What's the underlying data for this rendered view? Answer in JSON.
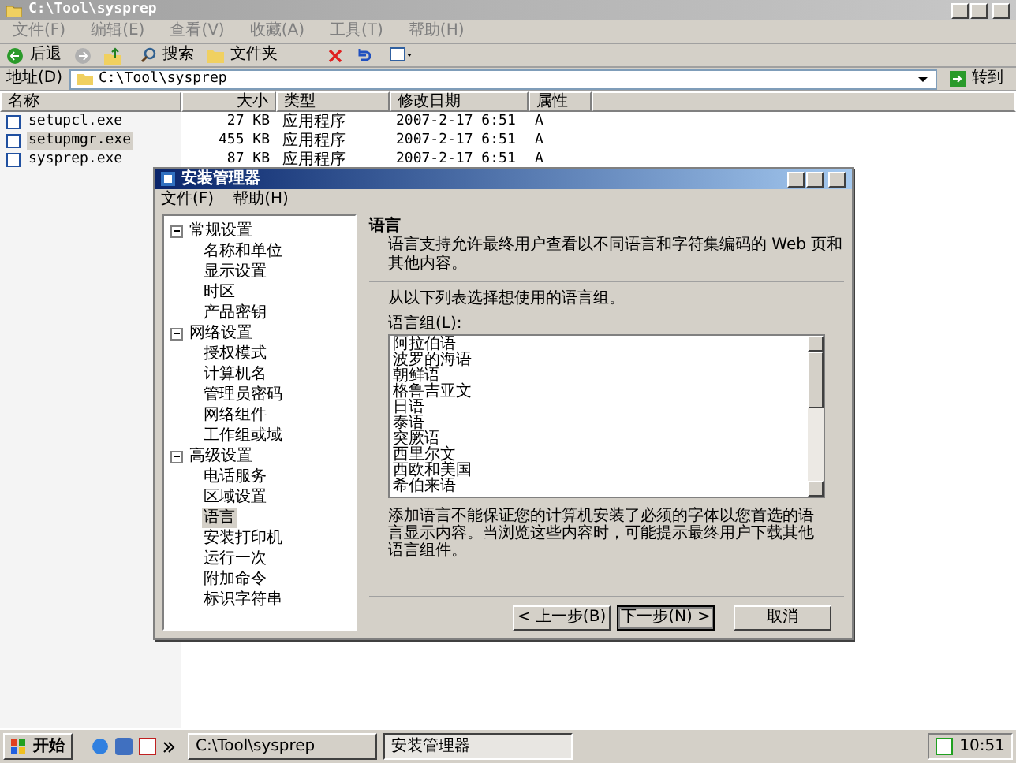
{
  "explorer": {
    "title": "C:\\Tool\\sysprep",
    "menu": [
      "文件(F)",
      "编辑(E)",
      "查看(V)",
      "收藏(A)",
      "工具(T)",
      "帮助(H)"
    ],
    "toolbar": {
      "back": "后退",
      "search": "搜索",
      "folders": "文件夹"
    },
    "address": {
      "label": "地址(D)",
      "value": "C:\\Tool\\sysprep",
      "go": "转到"
    },
    "columns": [
      "名称",
      "大小",
      "类型",
      "修改日期",
      "属性"
    ],
    "rows": [
      {
        "name": "setupcl.exe",
        "size": "27 KB",
        "type": "应用程序",
        "modified": "2007-2-17 6:51",
        "attr": "A",
        "selected": false
      },
      {
        "name": "setupmgr.exe",
        "size": "455 KB",
        "type": "应用程序",
        "modified": "2007-2-17 6:51",
        "attr": "A",
        "selected": true
      },
      {
        "name": "sysprep.exe",
        "size": "87 KB",
        "type": "应用程序",
        "modified": "2007-2-17 6:51",
        "attr": "A",
        "selected": false
      }
    ]
  },
  "dialog": {
    "title": "安装管理器",
    "menu": [
      "文件(F)",
      "帮助(H)"
    ],
    "tree": [
      {
        "label": "常规设置",
        "expanded": true,
        "selected": false,
        "children": [
          {
            "label": "名称和单位",
            "selected": false
          },
          {
            "label": "显示设置",
            "selected": false
          },
          {
            "label": "时区",
            "selected": false
          },
          {
            "label": "产品密钥",
            "selected": false
          }
        ]
      },
      {
        "label": "网络设置",
        "expanded": true,
        "selected": false,
        "children": [
          {
            "label": "授权模式",
            "selected": false
          },
          {
            "label": "计算机名",
            "selected": false
          },
          {
            "label": "管理员密码",
            "selected": false
          },
          {
            "label": "网络组件",
            "selected": false
          },
          {
            "label": "工作组或域",
            "selected": false
          }
        ]
      },
      {
        "label": "高级设置",
        "expanded": true,
        "selected": false,
        "children": [
          {
            "label": "电话服务",
            "selected": false
          },
          {
            "label": "区域设置",
            "selected": false
          },
          {
            "label": "语言",
            "selected": true
          },
          {
            "label": "安装打印机",
            "selected": false
          },
          {
            "label": "运行一次",
            "selected": false
          },
          {
            "label": "附加命令",
            "selected": false
          },
          {
            "label": "标识字符串",
            "selected": false
          }
        ]
      }
    ],
    "heading": "语言",
    "description": "语言支持允许最终用户查看以不同语言和字符集编码的 Web 页和其他内容。",
    "instruction": "从以下列表选择想使用的语言组。",
    "list_label": "语言组(L):",
    "languages": [
      "阿拉伯语",
      "波罗的海语",
      "朝鲜语",
      "格鲁吉亚文",
      "日语",
      "泰语",
      "突厥语",
      "西里尔文",
      "西欧和美国",
      "希伯来语"
    ],
    "note": "添加语言不能保证您的计算机安装了必须的字体以您首选的语言显示内容。当浏览这些内容时，可能提示最终用户下载其他语言组件。",
    "buttons": {
      "back": "< 上一步(B)",
      "next": "下一步(N) >",
      "cancel": "取消"
    }
  },
  "taskbar": {
    "start": "开始",
    "tasks": [
      {
        "label": "C:\\Tool\\sysprep",
        "selected": false
      },
      {
        "label": "安装管理器",
        "selected": true
      }
    ],
    "clock": "10:51"
  }
}
